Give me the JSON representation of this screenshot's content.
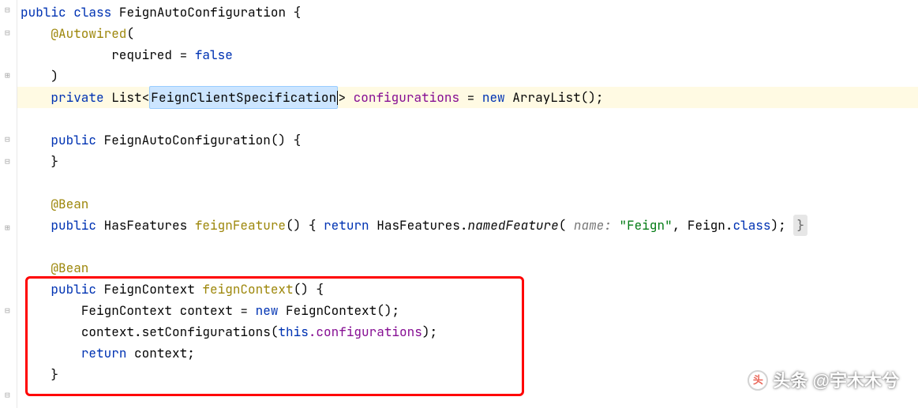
{
  "code": {
    "line1": {
      "kw1": "public",
      "kw2": "class",
      "name": "FeignAutoConfiguration",
      "brace": " {"
    },
    "line2": {
      "annotation": "@Autowired",
      "paren": "("
    },
    "line3": {
      "param": "required",
      "eq": " = ",
      "val": "false"
    },
    "line4": {
      "paren": ")"
    },
    "line5": {
      "kw1": "private",
      "type": "List",
      "lt": "<",
      "generic": "FeignClientSpecification",
      "gt": "> ",
      "field": "configurations",
      "eq": " = ",
      "kw2": "new",
      "ctor": " ArrayList();"
    },
    "line7": {
      "kw1": "public",
      "name": " FeignAutoConfiguration() {"
    },
    "line8": {
      "brace": "}"
    },
    "line10": {
      "annotation": "@Bean"
    },
    "line11": {
      "kw1": "public",
      "type": " HasFeatures ",
      "method": "feignFeature",
      "parens": "() { ",
      "kw2": "return",
      "call": " HasFeatures.",
      "method2": "namedFeature",
      "open": "(",
      "hint": " name: ",
      "str": "\"Feign\"",
      "rest": ", Feign.",
      "kw3": "class",
      "close": "); ",
      "fold": "}"
    },
    "line13": {
      "annotation": "@Bean"
    },
    "line14": {
      "kw1": "public",
      "type": " FeignContext ",
      "method": "feignContext",
      "rest": "() {"
    },
    "line15": {
      "type": "FeignContext ",
      "var": "context",
      "eq": " = ",
      "kw": "new",
      "ctor": " FeignContext();"
    },
    "line16": {
      "var": "context",
      "dot": ".setConfigurations(",
      "kw": "this",
      "field": ".configurations",
      "close": ");"
    },
    "line17": {
      "kw": "return",
      "var": " context;"
    },
    "line18": {
      "brace": "}"
    }
  },
  "watermark": {
    "logo": "头",
    "text": "头条 @宇木木兮"
  }
}
